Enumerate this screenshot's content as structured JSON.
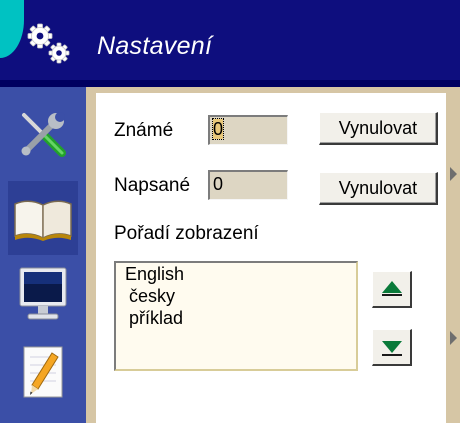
{
  "window": {
    "title": "Nastavení",
    "title_icon": "gears-icon",
    "colors": {
      "titlebar": "#0e0e7e",
      "accent": "#00c2c2",
      "sidebar": "#3b4fa7",
      "content_frame": "#d6c6a5"
    }
  },
  "sidebar": {
    "items": [
      {
        "icon": "tools-icon",
        "active": false
      },
      {
        "icon": "book-icon",
        "active": true
      },
      {
        "icon": "monitor-icon",
        "active": false
      },
      {
        "icon": "notepad-pencil-icon",
        "active": false
      }
    ]
  },
  "settings": {
    "known": {
      "label": "Známé",
      "value": "0",
      "reset_label": "Vynulovat"
    },
    "written": {
      "label": "Napsané",
      "value": "0",
      "reset_label": "Vynulovat"
    },
    "order": {
      "label": "Pořadí zobrazení",
      "items": [
        "English",
        "česky",
        "příklad"
      ],
      "move_up_icon": "arrow-up-icon",
      "move_down_icon": "arrow-down-icon"
    }
  }
}
